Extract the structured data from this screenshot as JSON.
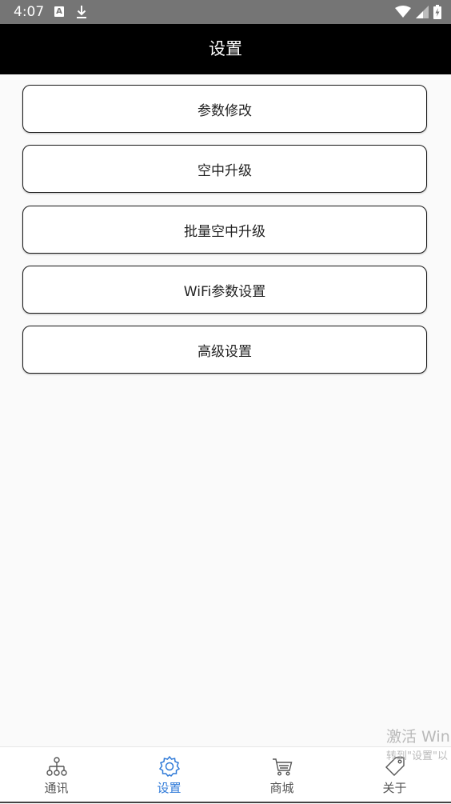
{
  "status_bar": {
    "time": "4:07",
    "notification_letter": "A",
    "icons": [
      "notification-a-icon",
      "download-icon",
      "wifi-icon",
      "signal-icon",
      "battery-charging-icon"
    ]
  },
  "header": {
    "title": "设置"
  },
  "menu": {
    "items": [
      {
        "label": "参数修改"
      },
      {
        "label": "空中升级"
      },
      {
        "label": "批量空中升级"
      },
      {
        "label": "WiFi参数设置"
      },
      {
        "label": "高级设置"
      }
    ]
  },
  "watermark": {
    "title": "激活 Win",
    "subtitle": "转到\"设置\"以"
  },
  "bottom_nav": {
    "active_index": 1,
    "active_color": "#2f7ad8",
    "items": [
      {
        "label": "通讯",
        "icon": "network-icon"
      },
      {
        "label": "设置",
        "icon": "gear-icon"
      },
      {
        "label": "商城",
        "icon": "cart-icon"
      },
      {
        "label": "关于",
        "icon": "tag-icon"
      }
    ]
  }
}
